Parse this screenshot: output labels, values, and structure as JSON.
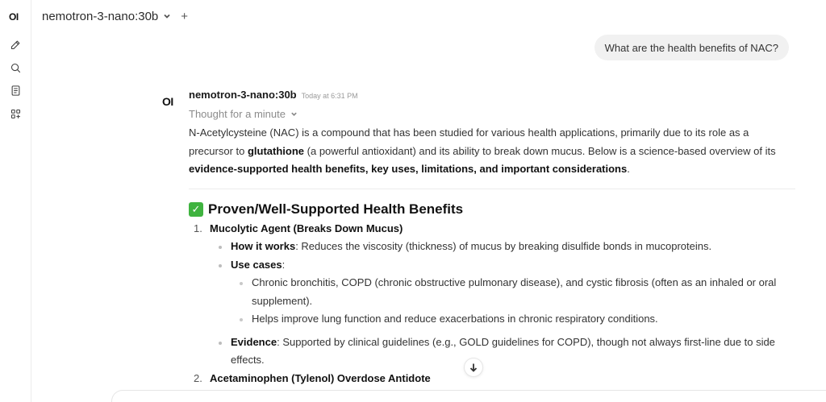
{
  "sidebar": {
    "logo": "OI",
    "icons": [
      "new-chat-icon",
      "search-icon",
      "notes-icon",
      "workspace-icon"
    ]
  },
  "topbar": {
    "model": "nemotron-3-nano:30b",
    "add_symbol": "+"
  },
  "user_message": "What are the health benefits of NAC?",
  "assistant": {
    "logo": "OI",
    "model": "nemotron-3-nano:30b",
    "timestamp": "Today at 6:31 PM",
    "thought_label": "Thought for a minute",
    "intro": {
      "t1": "N-Acetylcysteine (NAC) is a compound that has been studied for various health applications, primarily due to its role as a precursor to ",
      "b1": "glutathione",
      "t2": " (a powerful antioxidant) and its ability to break down mucus. Below is a science-based overview of its ",
      "b2": "evidence-supported health benefits, key uses, limitations, and important considerations",
      "t3": "."
    },
    "heading_emoji": "✓",
    "heading": "Proven/Well-Supported Health Benefits",
    "items": [
      {
        "num": "1.",
        "title": "Mucolytic Agent (Breaks Down Mucus)",
        "how_label": "How it works",
        "how_text": ": Reduces the viscosity (thickness) of mucus by breaking disulfide bonds in mucoproteins.",
        "use_label": "Use cases",
        "use_colon": ":",
        "use_sub1": "Chronic bronchitis, COPD (chronic obstructive pulmonary disease), and cystic fibrosis (often as an inhaled or oral supplement).",
        "use_sub2": "Helps improve lung function and reduce exacerbations in chronic respiratory conditions.",
        "evidence_label": "Evidence",
        "evidence_text": ": Supported by clinical guidelines (e.g., GOLD guidelines for COPD), though not always first-line due to side effects."
      },
      {
        "num": "2.",
        "title": "Acetaminophen (Tylenol) Overdose Antidote"
      }
    ]
  },
  "colors": {
    "accent_check": "#3fb33f",
    "bubble_bg": "#f1f1f1"
  }
}
